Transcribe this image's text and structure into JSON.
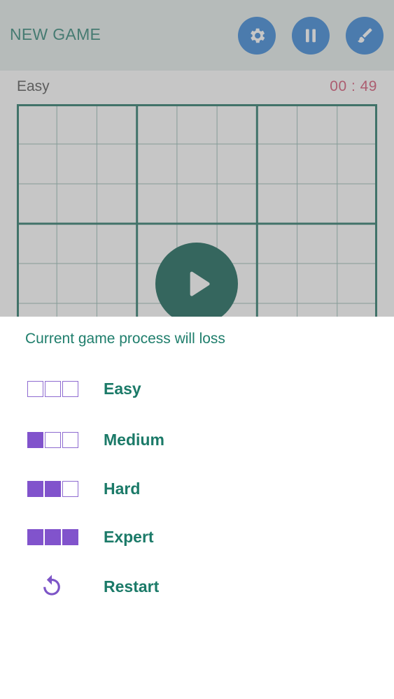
{
  "header": {
    "title": "NEW GAME",
    "icons": [
      "gear-icon",
      "pause-icon",
      "brush-icon"
    ]
  },
  "game": {
    "difficulty": "Easy",
    "timer": "00 : 49"
  },
  "sheet": {
    "message": "Current game process will loss",
    "options": [
      {
        "label": "Easy",
        "level_squares_filled": 0
      },
      {
        "label": "Medium",
        "level_squares_filled": 1
      },
      {
        "label": "Hard",
        "level_squares_filled": 2
      },
      {
        "label": "Expert",
        "level_squares_filled": 3
      },
      {
        "label": "Restart",
        "icon": "restart-icon"
      }
    ]
  },
  "colors": {
    "accent_green": "#1b7a68",
    "icon_button_blue": "#2b7fd5",
    "level_purple": "#8153cc",
    "timer_pink": "#d24a6c",
    "play_button": "#065a4c"
  }
}
